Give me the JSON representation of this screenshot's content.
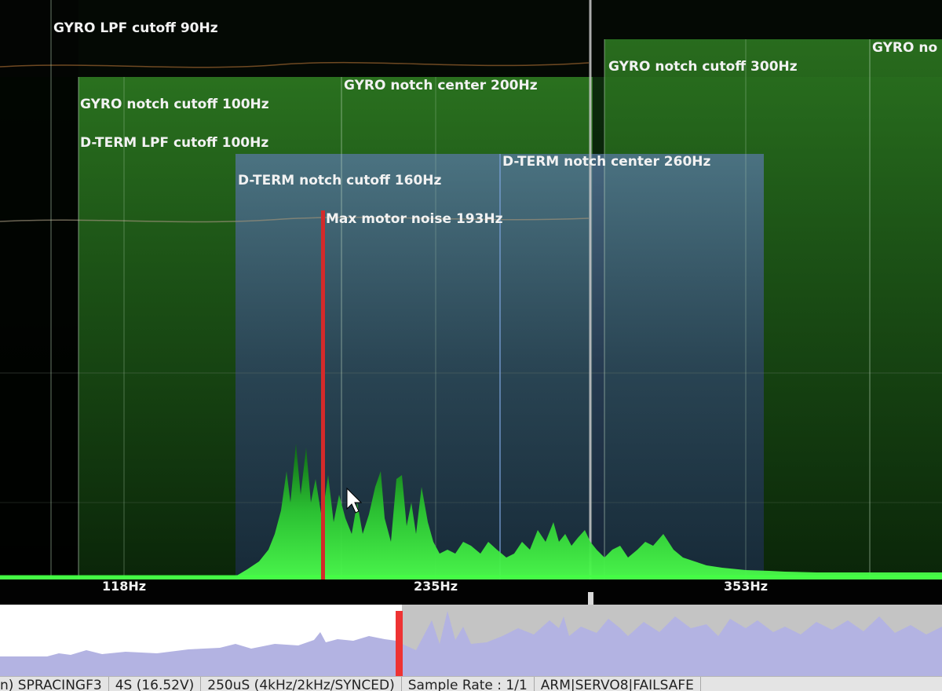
{
  "spectrum": {
    "filters": {
      "gyro_lpf": "GYRO LPF cutoff 90Hz",
      "gyro_notch1_cutoff": "GYRO notch cutoff 100Hz",
      "dterm_lpf": "D-TERM LPF cutoff 100Hz",
      "gyro_notch1_center": "GYRO notch center 200Hz",
      "dterm_notch_cutoff": "D-TERM notch cutoff 160Hz",
      "dterm_notch_center": "D-TERM notch center 260Hz",
      "gyro_notch2_cutoff": "GYRO notch cutoff 300Hz",
      "gyro_notch2_center": "GYRO no",
      "max_motor_noise": "Max motor noise 193Hz"
    },
    "axis_ticks": [
      "118Hz",
      "235Hz",
      "353Hz"
    ],
    "colors": {
      "gyro_notch_band": "#2f7a22",
      "dterm_notch_band": "#44648a",
      "spectrum_fill": "#35e63a",
      "max_noise_marker": "#d42a2a"
    }
  },
  "overview": {
    "colors": {
      "graph": "#b3b3e2",
      "cursor": "#ee3333",
      "selection": "#c6c6c6"
    }
  },
  "statusbar": {
    "segments": [
      "n) SPRACINGF3",
      "4S (16.52V)",
      "250uS (4kHz/2kHz/SYNCED)",
      "Sample Rate : 1/1",
      "ARM|SERVO8|FAILSAFE"
    ]
  }
}
